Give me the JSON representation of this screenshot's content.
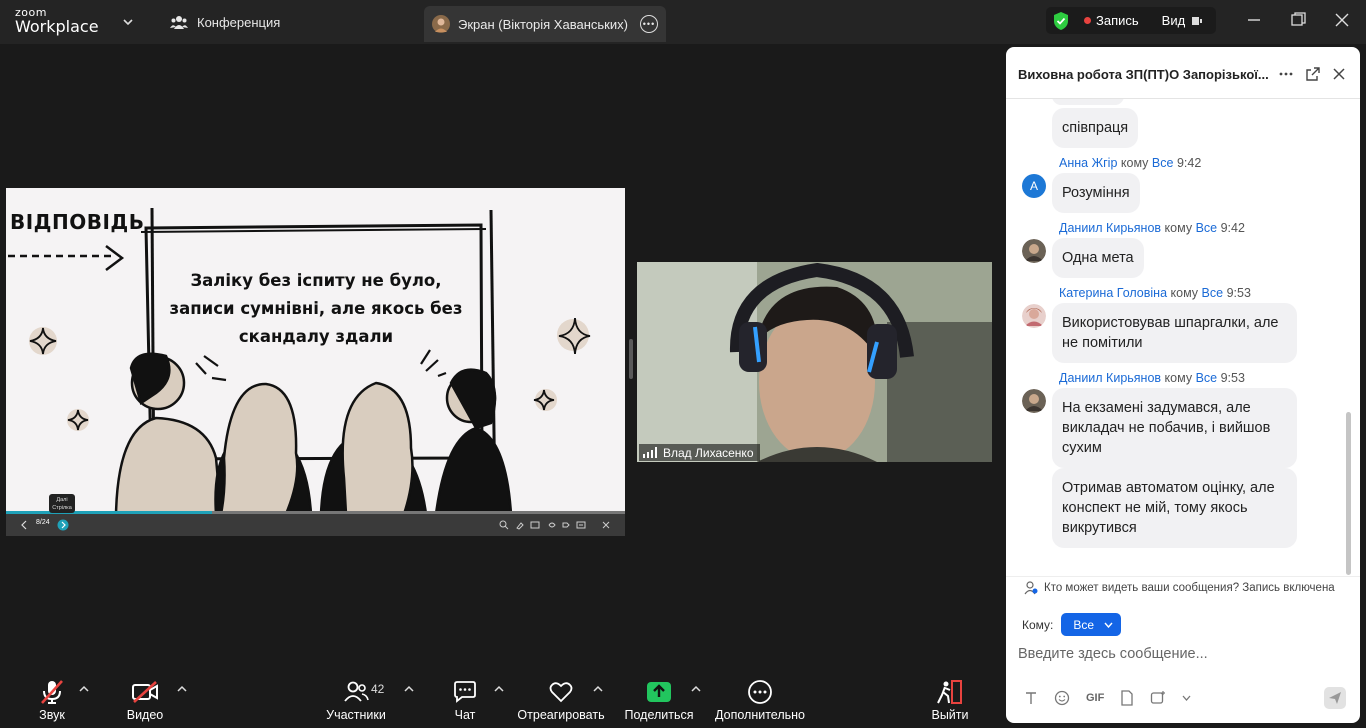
{
  "app": {
    "brand_top": "zoom",
    "brand_bottom": "Workplace"
  },
  "tabs": {
    "conference": "Конференция",
    "screen": "Экран (Вікторія Хаванських)"
  },
  "topbar": {
    "record_label": "Запись",
    "view_label": "Вид"
  },
  "slide": {
    "heading": "ВІДПОВІДЬ",
    "body": "Заліку без іспиту не було, записи сумнівні, але якось без скандалу здали",
    "page": "8/24",
    "tooltip_line1": "Далі",
    "tooltip_line2": "Стрілка",
    "progress_fraction": 0.333
  },
  "video": {
    "participant_name": "Влад Лихасенко"
  },
  "chat": {
    "title": "Виховна робота ЗП(ПТ)О Запорізької...",
    "to_word": "кому",
    "messages": [
      {
        "text": "співпраця"
      },
      {
        "sender": "Анна Жгір",
        "to": "Все",
        "time": "9:42",
        "avatar_letter": "А",
        "text": "Розуміння"
      },
      {
        "sender": "Даниил Кирьянов",
        "to": "Все",
        "time": "9:42",
        "text": "Одна мета"
      },
      {
        "sender": "Катерина Головіна",
        "to": "Все",
        "time": "9:53",
        "text": "Використовував шпаргалки, але не помітили"
      },
      {
        "sender": "Даниил Кирьянов",
        "to": "Все",
        "time": "9:53",
        "text": "На екзамені задумався, але викладач не побачив, і вийшов сухим"
      },
      {
        "text": "Отримав автоматом оцінку, але конспект не мій, тому якось викрутився"
      }
    ],
    "privacy_note": "Кто может видеть ваши сообщения? Запись включена",
    "recipient_label": "Кому:",
    "recipient_value": "Все",
    "input_placeholder": "Введите здесь сообщение...",
    "gif_label": "GIF"
  },
  "toolbar": {
    "audio": "Звук",
    "video": "Видео",
    "participants": "Участники",
    "participants_count": "42",
    "chat": "Чат",
    "react": "Отреагировать",
    "share": "Поделиться",
    "more": "Дополнительно",
    "leave": "Выйти"
  },
  "colors": {
    "accent": "#1465e6",
    "share_green": "#22c55e",
    "leave_red": "#e8433f",
    "shield_green": "#2ecc40",
    "progress_teal": "#1fa1b8"
  }
}
